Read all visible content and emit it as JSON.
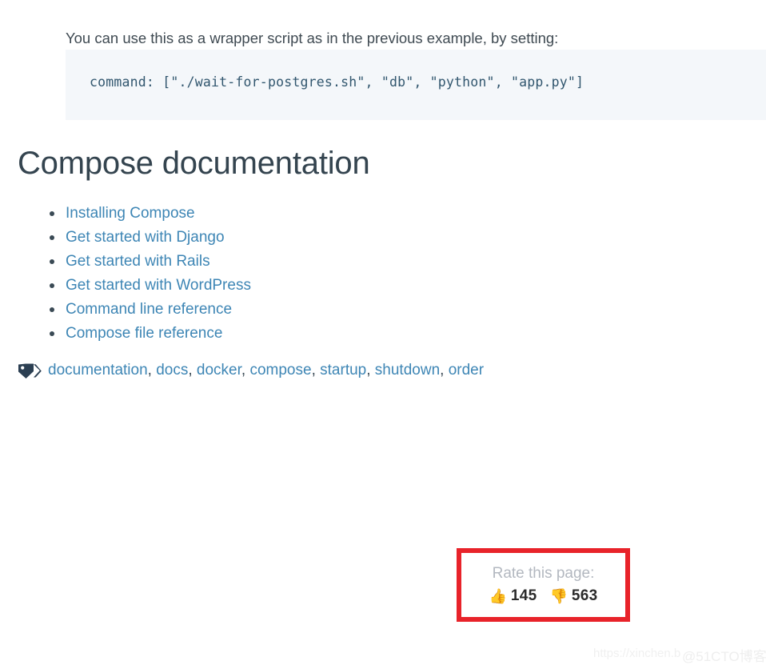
{
  "content": {
    "intro_paragraph": "You can use this as a wrapper script as in the previous example, by setting:",
    "code_snippet": "command: [\"./wait-for-postgres.sh\", \"db\", \"python\", \"app.py\"]",
    "heading": "Compose documentation"
  },
  "doc_links": [
    {
      "label": "Installing Compose"
    },
    {
      "label": "Get started with Django"
    },
    {
      "label": "Get started with Rails"
    },
    {
      "label": "Get started with WordPress"
    },
    {
      "label": "Command line reference"
    },
    {
      "label": "Compose file reference"
    }
  ],
  "tags": {
    "icon": "tag-icon",
    "items": [
      "documentation",
      "docs",
      "docker",
      "compose",
      "startup",
      "shutdown",
      "order"
    ],
    "separator": ", "
  },
  "rate_widget": {
    "label": "Rate this page:",
    "thumbs_up_icon": "thumbs-up-icon",
    "thumbs_up_emoji": "👍",
    "thumbs_up_count": "145",
    "thumbs_down_icon": "thumbs-down-icon",
    "thumbs_down_emoji": "👎",
    "thumbs_down_count": "563",
    "highlight_color": "#e8232a"
  },
  "watermark": {
    "url_text": "https://xinchen.b",
    "brand_text": "@51CTO博客"
  },
  "colors": {
    "link": "#3e86b5",
    "heading": "#34444f",
    "body_text": "#3f4a52",
    "code_bg": "#f4f7fa",
    "code_text": "#31566e",
    "rate_label": "#b3b8c0",
    "highlight": "#e8232a"
  }
}
